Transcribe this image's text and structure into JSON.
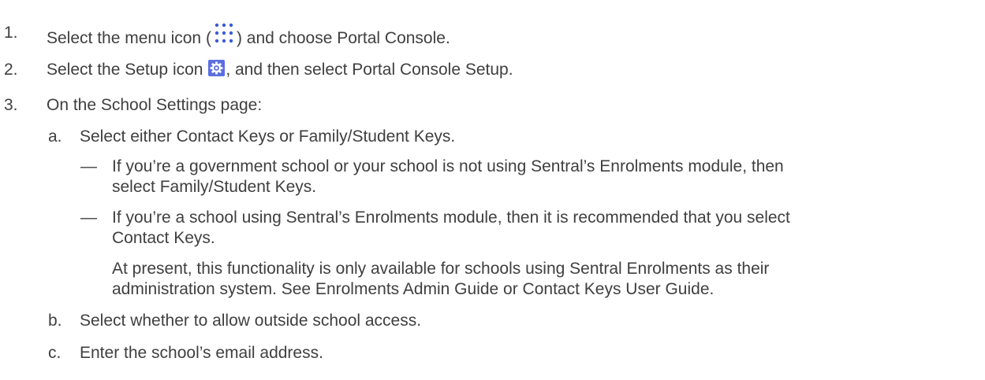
{
  "steps": [
    {
      "number": "1.",
      "before_icon": "Select the menu icon (",
      "icon": "menu-dots-icon",
      "after_icon": ") and choose Portal Console."
    },
    {
      "number": "2.",
      "before_icon": "Select the Setup icon ",
      "icon": "gear-icon",
      "after_icon": ", and then select Portal Console Setup."
    },
    {
      "number": "3.",
      "text": "On the School Settings page:",
      "substeps": [
        {
          "letter": "a.",
          "text": "Select either Contact Keys or Family/Student Keys.",
          "bullets": [
            {
              "dash": "—",
              "lines": [
                "If you’re a government school or your school is not using Sentral’s Enrolments module, then",
                "select Family/Student Keys."
              ]
            },
            {
              "dash": "—",
              "lines": [
                "If you’re a school using Sentral’s Enrolments module, then it is recommended that you select",
                "Contact Keys."
              ],
              "note_lines": [
                "At present, this functionality is only available for schools using Sentral Enrolments as their",
                "administration system. See Enrolments Admin Guide or Contact Keys User Guide."
              ]
            }
          ]
        },
        {
          "letter": "b.",
          "text": "Select whether to allow outside school access."
        },
        {
          "letter": "c.",
          "text": "Enter the school’s email address."
        }
      ]
    }
  ],
  "colors": {
    "text": "#3f3f3f",
    "menu_icon": "#3b5bd6",
    "setup_icon_bg": "#5b6ee1"
  }
}
